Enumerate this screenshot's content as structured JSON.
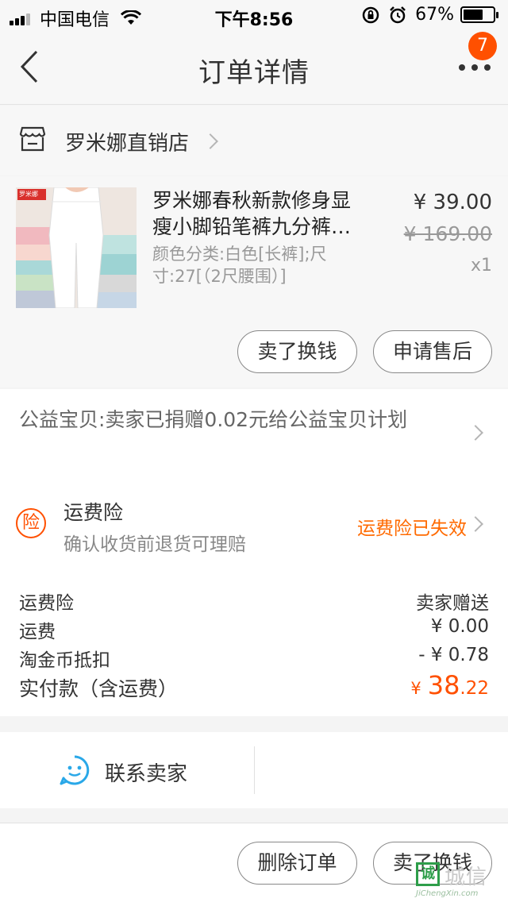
{
  "status_bar": {
    "carrier": "中国电信",
    "time": "下午8:56",
    "battery_percent": "67%",
    "battery_level": 0.67,
    "icons": [
      "signal-icon",
      "wifi-icon",
      "rotation-lock-icon",
      "alarm-icon",
      "battery-icon"
    ]
  },
  "nav": {
    "title": "订单详情",
    "badge_count": "7",
    "icons": [
      "back-chevron-icon",
      "more-dots-icon"
    ]
  },
  "shop": {
    "name": "罗米娜直销店",
    "icon": "store-icon"
  },
  "item": {
    "title": "罗米娜春秋新款修身显瘦小脚铅笔裤九分裤…",
    "sku": "颜色分类:白色[长裤];尺寸:27[（2尺腰围）]",
    "price": "¥ 39.00",
    "original_price": "¥ 169.00",
    "quantity": "x1",
    "thumb_brand": "罗米娜",
    "sell_button": "卖了换钱",
    "after_sale_button": "申请售后"
  },
  "charity": {
    "text": "公益宝贝:卖家已捐赠0.02元给公益宝贝计划"
  },
  "insurance": {
    "icon_char": "险",
    "title": "运费险",
    "subtitle": "确认收货前退货可理赔",
    "status": "运费险已失效"
  },
  "summary": {
    "rows": [
      {
        "label": "运费险",
        "value": "卖家赠送"
      },
      {
        "label": "运费",
        "value": "¥ 0.00"
      },
      {
        "label": "淘金币抵扣",
        "value": "- ¥ 0.78"
      }
    ],
    "total_label": "实付款（含运费）",
    "total_currency": "¥",
    "total_integer": "38",
    "total_decimal": ".22"
  },
  "contact": {
    "label": "联系卖家",
    "icon": "smiley-chat-icon"
  },
  "bottom": {
    "delete_button": "删除订单",
    "sell_button": "卖了换钱"
  },
  "watermark": {
    "mark": "诚",
    "text": "城信",
    "site": "JiChengXin.com"
  },
  "colors": {
    "accent": "#ff5000",
    "status_orange": "#ff6a00",
    "text": "#333333",
    "muted": "#999999"
  }
}
